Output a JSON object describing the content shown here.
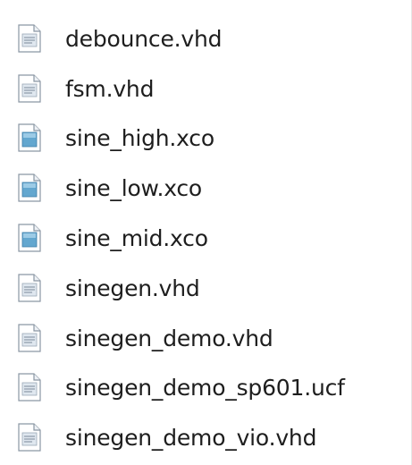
{
  "files": [
    {
      "name": "debounce.vhd",
      "icon": "text-file-icon"
    },
    {
      "name": "fsm.vhd",
      "icon": "text-file-icon"
    },
    {
      "name": "sine_high.xco",
      "icon": "blue-file-icon"
    },
    {
      "name": "sine_low.xco",
      "icon": "blue-file-icon"
    },
    {
      "name": "sine_mid.xco",
      "icon": "blue-file-icon"
    },
    {
      "name": "sinegen.vhd",
      "icon": "text-file-icon"
    },
    {
      "name": "sinegen_demo.vhd",
      "icon": "text-file-icon"
    },
    {
      "name": "sinegen_demo_sp601.ucf",
      "icon": "text-file-icon"
    },
    {
      "name": "sinegen_demo_vio.vhd",
      "icon": "text-file-icon"
    }
  ],
  "colors": {
    "text": "#1e1e1e",
    "icon_border": "#8a96a3",
    "text_file_fill": "#dfe7ef",
    "blue_file_fill": "#63a7cf"
  }
}
